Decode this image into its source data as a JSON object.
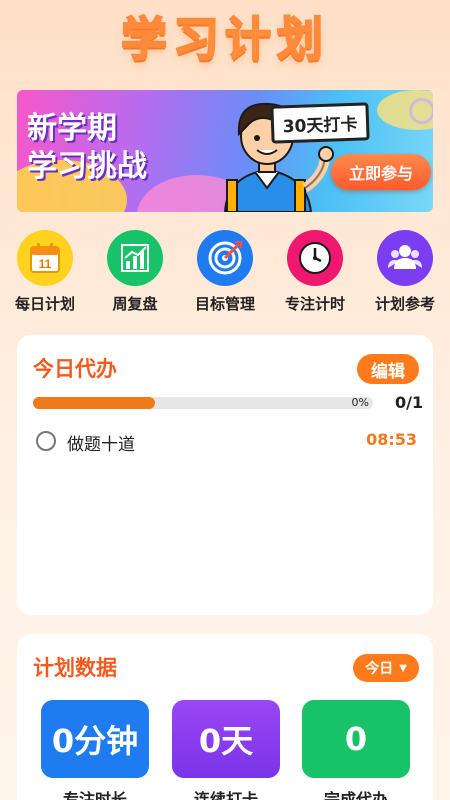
{
  "app": {
    "title": "学习计划"
  },
  "banner": {
    "line1": "新学期",
    "line2": "学习挑战",
    "sign": "30天打卡",
    "cta": "立即参与"
  },
  "quick_menu": [
    {
      "label": "每日计划",
      "icon": "calendar-icon",
      "color": "#ffd21f",
      "day": "11"
    },
    {
      "label": "周复盘",
      "icon": "chart-icon",
      "color": "#18c268"
    },
    {
      "label": "目标管理",
      "icon": "target-icon",
      "color": "#1e7cf0"
    },
    {
      "label": "专注计时",
      "icon": "clock-icon",
      "color": "#f0186e"
    },
    {
      "label": "计划参考",
      "icon": "people-icon",
      "color": "#7a3ef0"
    }
  ],
  "todo": {
    "title": "今日代办",
    "edit_label": "编辑",
    "progress_percent": 0,
    "progress_pct_text": "0%",
    "progress_count": "0/1",
    "tasks": [
      {
        "name": "做题十道",
        "time": "08:53",
        "done": false
      }
    ]
  },
  "stats": {
    "title": "计划数据",
    "range": "今日",
    "tiles": [
      {
        "value": "0分钟",
        "label": "专注时长",
        "color": "#1e7cf0"
      },
      {
        "value": "0天",
        "label": "连续打卡",
        "color": "#8a3ef0"
      },
      {
        "value": "0",
        "label": "完成代办",
        "color": "#18c268"
      }
    ]
  },
  "colors": {
    "accent": "#ff7a1a",
    "title": "#f45a1e"
  }
}
